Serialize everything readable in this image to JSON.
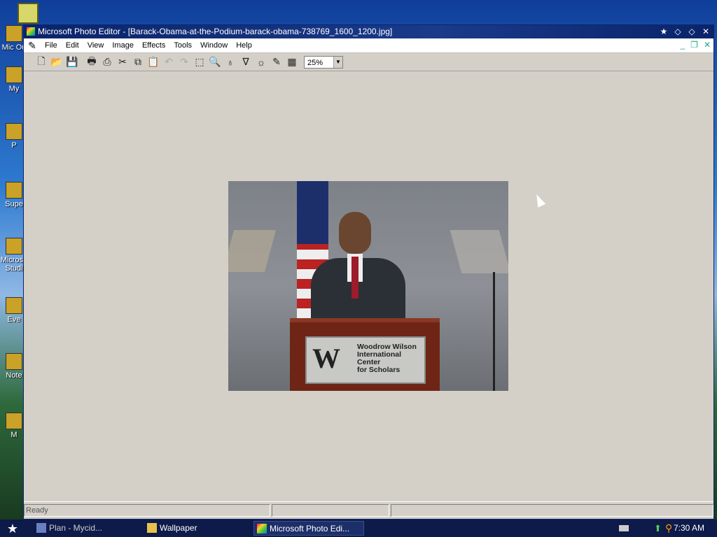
{
  "window": {
    "title": "Microsoft Photo Editor - [Barack-Obama-at-the-Podium-barack-obama-738769_1600_1200.jpg]"
  },
  "menu": {
    "items": [
      "File",
      "Edit",
      "View",
      "Image",
      "Effects",
      "Tools",
      "Window",
      "Help"
    ]
  },
  "toolbar": {
    "zoom_value": "25%"
  },
  "photo": {
    "plaque_logo": "W",
    "plaque_text": [
      "Woodrow Wilson",
      "International",
      "Center",
      "for Scholars"
    ]
  },
  "status": {
    "text": "Ready"
  },
  "desktop": {
    "icons": [
      "Mic Ou",
      "My",
      "P",
      "Supe",
      "Microso Studi",
      "Eve",
      "Note",
      "M"
    ]
  },
  "taskbar": {
    "tasks": [
      "Plan - Mycid...",
      "Wallpaper",
      "Microsoft Photo Edi..."
    ],
    "time": "7:30 AM"
  },
  "colors": {
    "titlebar": "#0a246a",
    "workspace": "#d4d0c8",
    "taskbar": "#0d1a4a"
  }
}
